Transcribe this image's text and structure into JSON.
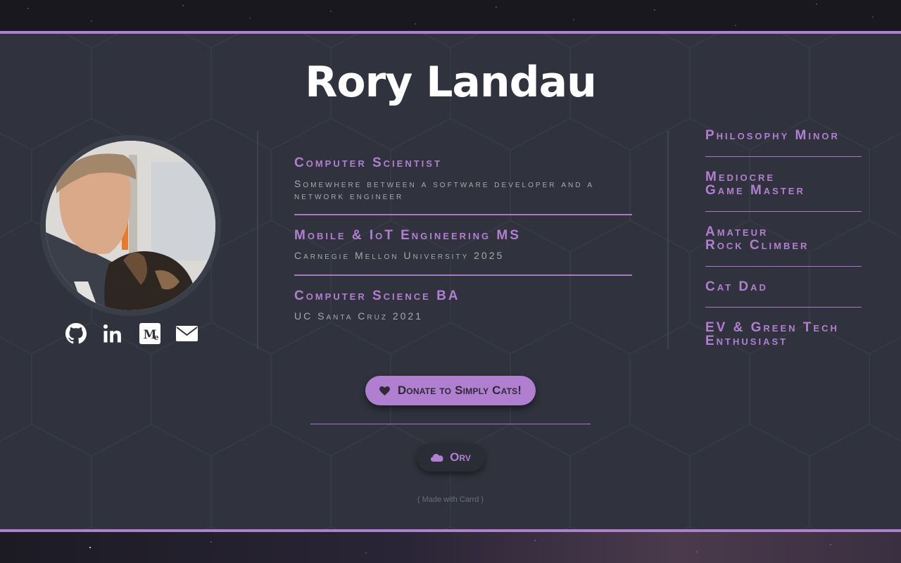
{
  "profile": {
    "name": "Rory Landau"
  },
  "social": {
    "links": [
      {
        "name": "github-icon"
      },
      {
        "name": "linkedin-icon"
      },
      {
        "name": "medium-icon"
      },
      {
        "name": "email-icon"
      }
    ]
  },
  "roles": [
    {
      "title": "Computer Scientist",
      "subtitle": "Somewhere between a software developer and a network engineer"
    },
    {
      "title": "Mobile & IoT Engineering MS",
      "subtitle": "Carnegie Mellon University 2025"
    },
    {
      "title": "Computer Science BA",
      "subtitle": "UC Santa Cruz 2021"
    }
  ],
  "traits": [
    {
      "line1": "Philosophy Minor",
      "line2": ""
    },
    {
      "line1": "Mediocre",
      "line2": "Game Master"
    },
    {
      "line1": "Amateur",
      "line2": "Rock Climber"
    },
    {
      "line1": "Cat Dad",
      "line2": ""
    },
    {
      "line1": "EV & Green Tech",
      "line2": "Enthusiast"
    }
  ],
  "buttons": {
    "donate": "Donate to Simply Cats!",
    "orv": "Orv"
  },
  "footer": {
    "made_with": "( Made with Carrd )"
  },
  "colors": {
    "accent": "#b07fd0",
    "panel": "#30333d",
    "title": "#ffffff",
    "subtitle": "#a8a9b0"
  }
}
